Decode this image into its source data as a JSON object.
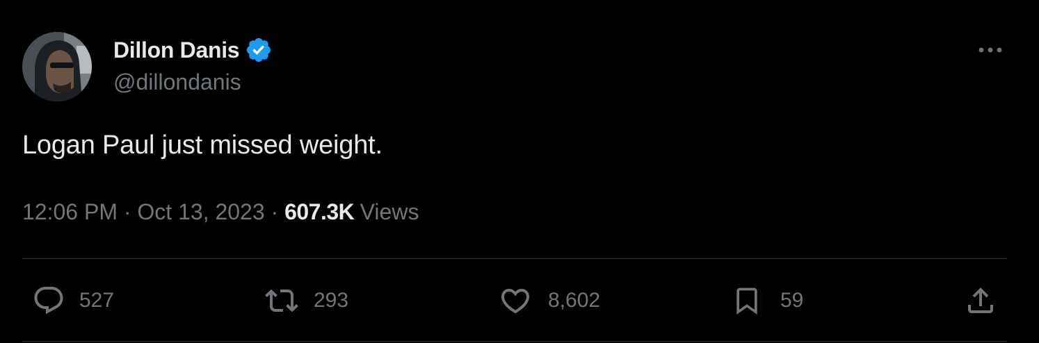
{
  "author": {
    "display_name": "Dillon Danis",
    "handle": "@dillondanis",
    "verified_color": "#1d9bf0"
  },
  "tweet": {
    "text": "Logan Paul just missed weight."
  },
  "meta": {
    "time": "12:06 PM",
    "separator": "·",
    "date": "Oct 13, 2023",
    "views_count": "607.3K",
    "views_label": "Views"
  },
  "actions": {
    "replies": "527",
    "retweets": "293",
    "likes": "8,602",
    "bookmarks": "59"
  },
  "icons": {
    "more": "more-horizontal-icon",
    "reply": "reply-bubble-icon",
    "retweet": "retweet-icon",
    "like": "heart-icon",
    "bookmark": "bookmark-icon",
    "share": "share-upload-icon",
    "verified": "verified-badge-icon"
  },
  "colors": {
    "background": "#000000",
    "primary_text": "#e7e9ea",
    "secondary_text": "#71767b",
    "divider": "#2f3336"
  }
}
